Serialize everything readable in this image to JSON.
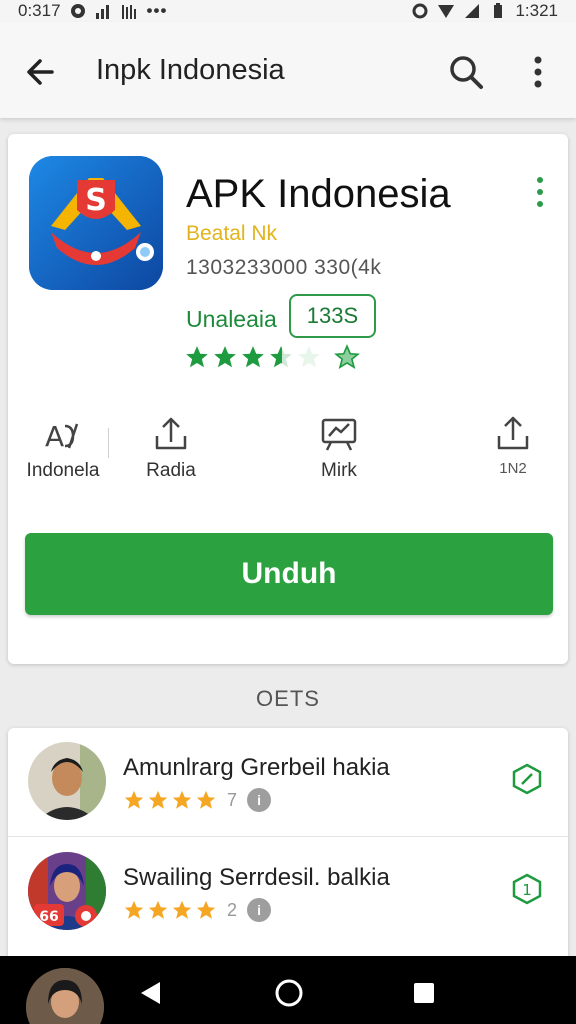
{
  "status_bar": {
    "left_time": "0:317",
    "right_time": "1:321"
  },
  "app_bar": {
    "title": "Inpk Indonesia",
    "back_icon": "arrow-left-icon",
    "search_icon": "search-icon",
    "more_icon": "more-vert-icon"
  },
  "app": {
    "name": "APK Indonesia",
    "developer": "Beatal Nk",
    "downloads": "1303233000 330(4k",
    "category": "Unaleaia",
    "rating_badge": "133S",
    "stars_filled": 3.5,
    "stars_total": 5,
    "icon": "app-logo-icon"
  },
  "info_items": [
    {
      "label": "Indonela",
      "icon": "translate-icon"
    },
    {
      "label": "Radia",
      "icon": "upload-icon"
    },
    {
      "label": "Mirk",
      "icon": "chart-board-icon"
    },
    {
      "label": "1N2",
      "icon": "share-icon"
    }
  ],
  "install_button": {
    "label": "Unduh"
  },
  "section": {
    "title": "OETS"
  },
  "reviews": [
    {
      "name": "Amunlrarg Grerbeil hakia",
      "stars": 4,
      "count": "7",
      "info": "i",
      "action_icon": "edit-badge-icon"
    },
    {
      "name": "Swailing Serrdesil. balkia",
      "stars": 4,
      "count": "2",
      "info": "i",
      "action_icon": "number-badge-icon"
    }
  ],
  "nav_bar": {
    "back": "back-triangle-icon",
    "home": "home-circle-icon",
    "recent": "recent-square-icon"
  },
  "colors": {
    "accent_green": "#2ba140",
    "developer_yellow": "#e2b31c",
    "star_green": "#1e9a3f",
    "star_orange": "#f5a623"
  }
}
